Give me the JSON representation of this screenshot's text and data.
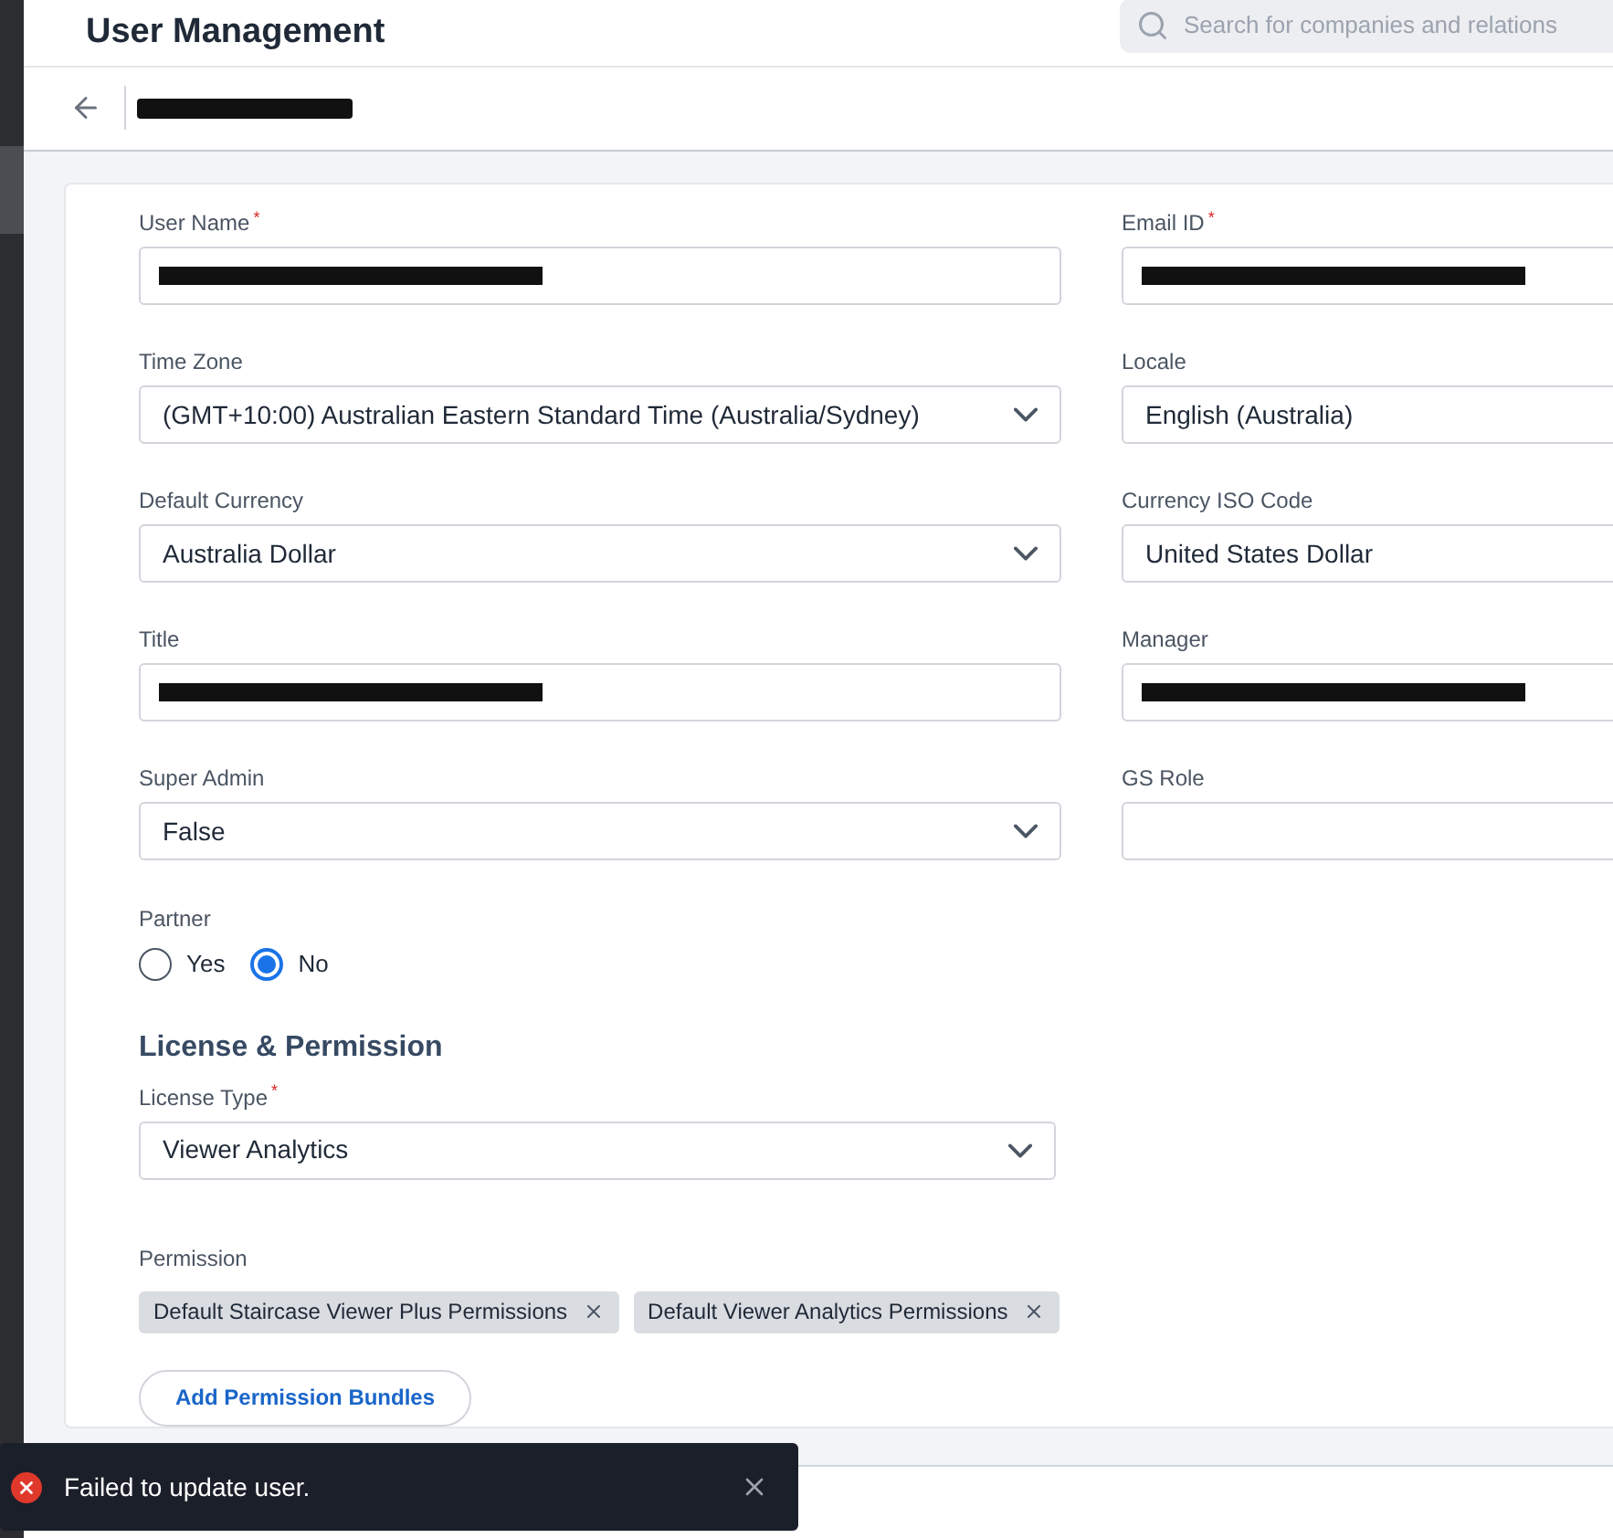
{
  "header": {
    "title": "User Management",
    "search": {
      "placeholder": "Search for companies and relations"
    }
  },
  "subheader": {
    "user_name_redacted": true
  },
  "fields": [
    {
      "label": "User Name",
      "required_mark": "*",
      "kind": "text",
      "redacted": true
    },
    {
      "label": "Email ID",
      "required_mark": "*",
      "kind": "text",
      "redacted": true
    },
    {
      "label": "Time Zone",
      "kind": "select",
      "value": "(GMT+10:00) Australian Eastern Standard Time (Australia/Sydney)"
    },
    {
      "label": "Locale",
      "kind": "text",
      "value": "English (Australia)"
    },
    {
      "label": "Default Currency",
      "kind": "select",
      "value": "Australia Dollar"
    },
    {
      "label": "Currency ISO Code",
      "kind": "text",
      "value": "United States Dollar"
    },
    {
      "label": "Title",
      "kind": "text",
      "redacted": true
    },
    {
      "label": "Manager",
      "kind": "text",
      "redacted": true
    },
    {
      "label": "Super Admin",
      "kind": "select",
      "value": "False"
    },
    {
      "label": "GS Role",
      "kind": "text"
    }
  ],
  "partner": {
    "label": "Partner",
    "options": [
      {
        "label": "Yes",
        "selected": false
      },
      {
        "label": "No",
        "selected": true
      }
    ]
  },
  "license_section": {
    "heading": "License & Permission",
    "license_type": {
      "label": "License Type",
      "required_mark": "*",
      "kind": "select",
      "value": "Viewer Analytics"
    },
    "permission": {
      "label": "Permission",
      "tags": [
        "Default Staircase Viewer Plus Permissions",
        "Default Viewer Analytics Permissions"
      ]
    },
    "add_button": "Add Permission Bundles"
  },
  "toast": {
    "kind": "error",
    "message": "Failed to update user."
  }
}
